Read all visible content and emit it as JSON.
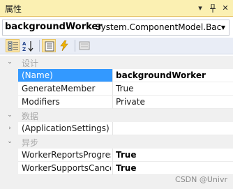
{
  "window": {
    "title": "属性",
    "buttons": [
      "▾",
      "📌",
      "✕"
    ]
  },
  "object_selector": {
    "name": "backgroundWorker",
    "type": "System.ComponentModel.Back"
  },
  "toolbar": {
    "buttons": [
      {
        "name": "categorized-button",
        "icon": "categorized-icon",
        "active": true
      },
      {
        "name": "alphabetical-button",
        "icon": "sort-az-icon",
        "active": false
      },
      {
        "name": "properties-button",
        "icon": "properties-icon",
        "active": true
      },
      {
        "name": "events-button",
        "icon": "lightning-icon",
        "active": false
      },
      {
        "name": "property-pages-button",
        "icon": "property-pages-icon",
        "active": false
      }
    ]
  },
  "grid": {
    "categories": [
      {
        "label": "设计",
        "expanded": true,
        "rows": [
          {
            "name": "(Name)",
            "value": "backgroundWorker",
            "bold": true,
            "selected": true
          },
          {
            "name": "GenerateMember",
            "value": "True",
            "bold": false
          },
          {
            "name": "Modifiers",
            "value": "Private",
            "bold": false
          }
        ]
      },
      {
        "label": "数据",
        "expanded": true,
        "rows": [
          {
            "name": "(ApplicationSettings)",
            "value": "",
            "bold": false,
            "expandable": true
          }
        ]
      },
      {
        "label": "异步",
        "expanded": true,
        "rows": [
          {
            "name": "WorkerReportsProgress",
            "value": "True",
            "bold": true
          },
          {
            "name": "WorkerSupportsCancellation",
            "value": "True",
            "bold": true
          }
        ]
      }
    ]
  },
  "watermark": "CSDN @Univr",
  "colors": {
    "title_bg": "#fbf0b2",
    "toolbar_bg": "#e9edf6",
    "selection": "#3399ff",
    "category_text": "#a7a7a7"
  }
}
